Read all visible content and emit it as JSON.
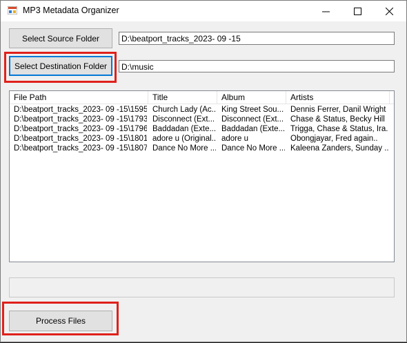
{
  "window": {
    "title": "MP3 Metadata Organizer",
    "controls": {
      "minimize": "—",
      "maximize": "□",
      "close": "✕"
    }
  },
  "source": {
    "button_label": "Select Source Folder",
    "path": "D:\\beatport_tracks_2023- 09 -15"
  },
  "destination": {
    "button_label": "Select Destination Folder",
    "path": "D:\\music"
  },
  "table": {
    "columns": [
      "File Path",
      "Title",
      "Album",
      "Artists"
    ],
    "rows": [
      [
        "D:\\beatport_tracks_2023- 09 -15\\1595...",
        "Church Lady (Ac...",
        "King Street Sou...",
        "Dennis Ferrer, Danil Wright"
      ],
      [
        "D:\\beatport_tracks_2023- 09 -15\\1793...",
        "Disconnect (Ext...",
        "Disconnect (Ext...",
        "Chase & Status, Becky Hill"
      ],
      [
        "D:\\beatport_tracks_2023- 09 -15\\1796...",
        "Baddadan (Exte...",
        "Baddadan (Exte...",
        "Trigga, Chase & Status, Ira..."
      ],
      [
        "D:\\beatport_tracks_2023- 09 -15\\1801...",
        "adore u (Original...",
        "adore u",
        "Obongjayar, Fred again.."
      ],
      [
        "D:\\beatport_tracks_2023- 09 -15\\1807...",
        "Dance No More ...",
        "Dance No More ...",
        "Kaleena Zanders, Sunday ..."
      ]
    ]
  },
  "status_text": "",
  "process": {
    "button_label": "Process Files"
  },
  "colors": {
    "highlight": "#e0201b",
    "focus": "#0078d7"
  }
}
